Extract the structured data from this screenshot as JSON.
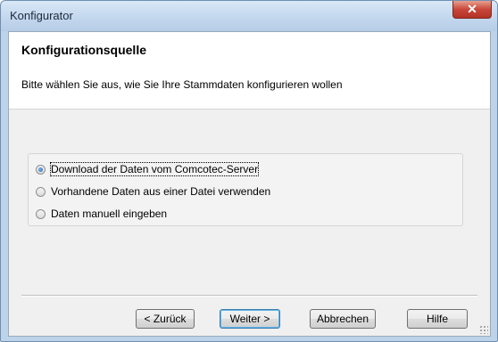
{
  "window": {
    "title": "Konfigurator",
    "close_symbol": "✕"
  },
  "header": {
    "title": "Konfigurationsquelle",
    "description": "Bitte wählen Sie aus, wie Sie Ihre Stammdaten konfigurieren wollen"
  },
  "options": [
    {
      "label": "Download der Daten vom Comcotec-Server",
      "checked": true
    },
    {
      "label": "Vorhandene Daten aus einer Datei verwenden",
      "checked": false
    },
    {
      "label": "Daten manuell eingeben",
      "checked": false
    }
  ],
  "buttons": {
    "back": "< Zurück",
    "next": "Weiter >",
    "cancel": "Abbrechen",
    "help": "Hilfe"
  }
}
